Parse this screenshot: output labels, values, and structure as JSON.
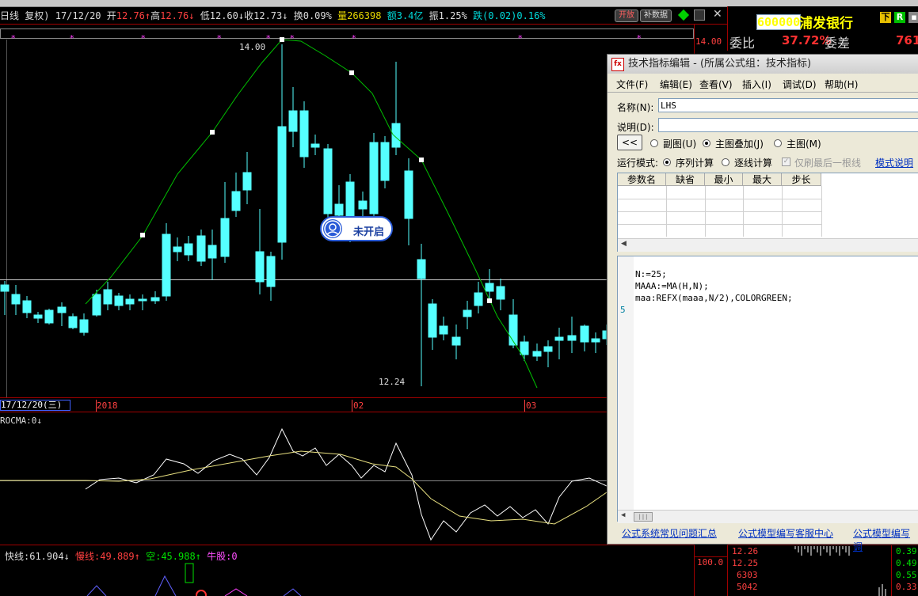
{
  "menubar": {
    "visible": true
  },
  "infoline": {
    "period": "日线",
    "adjust": "复权)",
    "date": "17/12/20",
    "open_label": "开",
    "open": "12.76↑",
    "high_label": "高",
    "high": "12.76↓",
    "low_label": "低",
    "low": "12.60↓",
    "close_label": "收",
    "close": "12.73↓",
    "turnover_label": "换",
    "turnover": "0.09%",
    "volume_label": "量",
    "volume": "266398",
    "amount_label": "额",
    "amount": "3.4亿",
    "amplitude_label": "振",
    "amplitude": "1.25%",
    "change_label": "跌",
    "change": "(0.02)",
    "change_pct": "0.16%"
  },
  "top_buttons": {
    "b1": "开放",
    "b2": "补数据"
  },
  "quote": {
    "code": "600000",
    "name": "浦发银行",
    "btn_down": "下",
    "btn_r": "R",
    "weibi_label": "委比",
    "weibi_value": "37.72%",
    "weicha_label": "委差",
    "weicha_value": "761"
  },
  "chart": {
    "price_high_label": "14.00",
    "price_low_label": "12.24",
    "right_axis_top": "14.00",
    "date_cursor": "17/12/20(三)",
    "date_2018": "2018",
    "date_02": "02",
    "date_03": "03",
    "indicator_name": "ROCMA:0↓",
    "colors": {
      "up": "#ff3030",
      "down": "#55ffff",
      "ma": "#00c000",
      "roc": "#ffffff",
      "rocma": "#e8e080"
    }
  },
  "tag": {
    "label": "未开启"
  },
  "dialog": {
    "title": "技术指标编辑 - (所属公式组：技术指标)",
    "menus": [
      "文件(F)",
      "编辑(E)",
      "查看(V)",
      "插入(I)",
      "调试(D)",
      "帮助(H)"
    ],
    "name_label": "名称(N):",
    "name_value": "LHS",
    "desc_label": "说明(D):",
    "desc_value": "",
    "back_btn": "<<",
    "radio_sub": "副图(U)",
    "radio_main_overlay": "主图叠加(J)",
    "radio_main": "主图(M)",
    "run_mode_label": "运行模式:",
    "mode_seq": "序列计算",
    "mode_line": "逐线计算",
    "refresh_last": "仅刷最后一根线",
    "mode_help": "模式说明",
    "param_headers": [
      "参数名",
      "缺省",
      "最小",
      "最大",
      "步长"
    ],
    "code_lines": [
      "N:=25;",
      "MAAA:=MA(H,N);",
      "maa:REFX(maaa,N/2),COLORGREEN;"
    ],
    "gutter_number": "5",
    "links": [
      "公式系统常见问题汇总",
      "公式模型编写客服中心",
      "公式模型编写调"
    ]
  },
  "bottom": {
    "fast_label": "快线:",
    "fast_value": "61.904↓",
    "slow_label": "慢线:",
    "slow_value": "49.889↑",
    "empty_label": "空:",
    "empty_value": "45.988↑",
    "bull_label": "牛股:",
    "bull_value": "0",
    "axis_100": "100.0",
    "side_prices": [
      "12.26",
      "12.25"
    ],
    "side_vols": [
      "6303",
      "5042"
    ],
    "side_right": [
      "0.39",
      "0.49",
      "0.55",
      "0.33"
    ]
  }
}
